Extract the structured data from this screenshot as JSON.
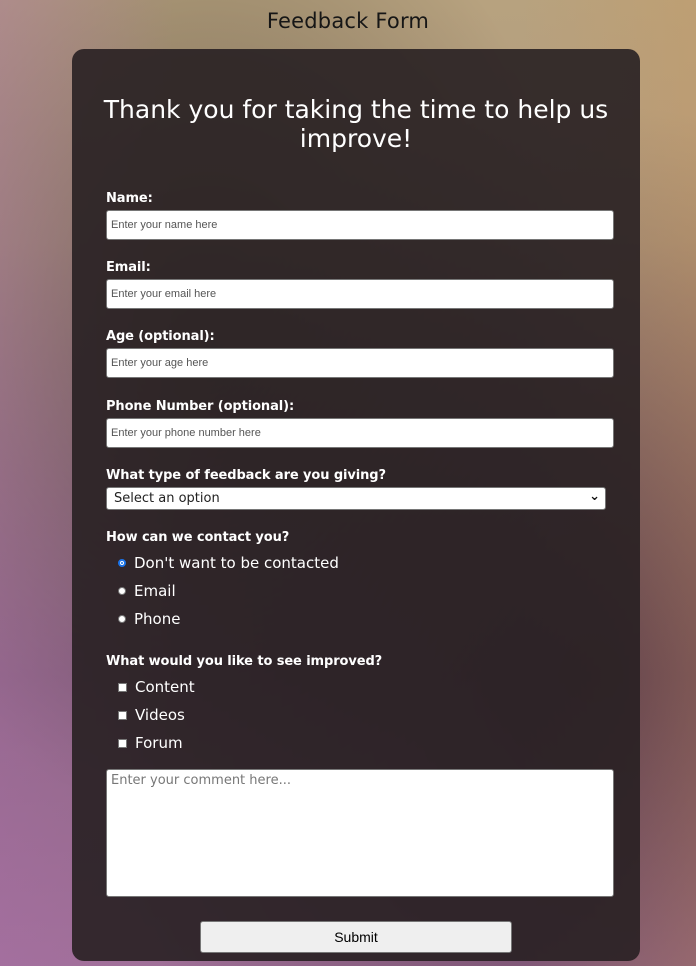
{
  "page": {
    "title": "Feedback Form"
  },
  "form": {
    "headline": "Thank you for taking the time to help us improve!",
    "name": {
      "label": "Name:",
      "placeholder": "Enter your name here"
    },
    "email": {
      "label": "Email:",
      "placeholder": "Enter your email here"
    },
    "age": {
      "label": "Age (optional):",
      "placeholder": "Enter your age here"
    },
    "phone": {
      "label": "Phone Number (optional):",
      "placeholder": "Enter your phone number here"
    },
    "feedback_type": {
      "label": "What type of feedback are you giving?",
      "selected": "Select an option"
    },
    "contact": {
      "label": "How can we contact you?",
      "options": [
        "Don't want to be contacted",
        "Email",
        "Phone"
      ],
      "selected_index": 0
    },
    "improve": {
      "label": "What would you like to see improved?",
      "options": [
        "Content",
        "Videos",
        "Forum"
      ]
    },
    "comment": {
      "placeholder": "Enter your comment here..."
    },
    "submit_label": "Submit"
  },
  "colors": {
    "card": "#282022",
    "radio_selected": "#1a73e8"
  }
}
